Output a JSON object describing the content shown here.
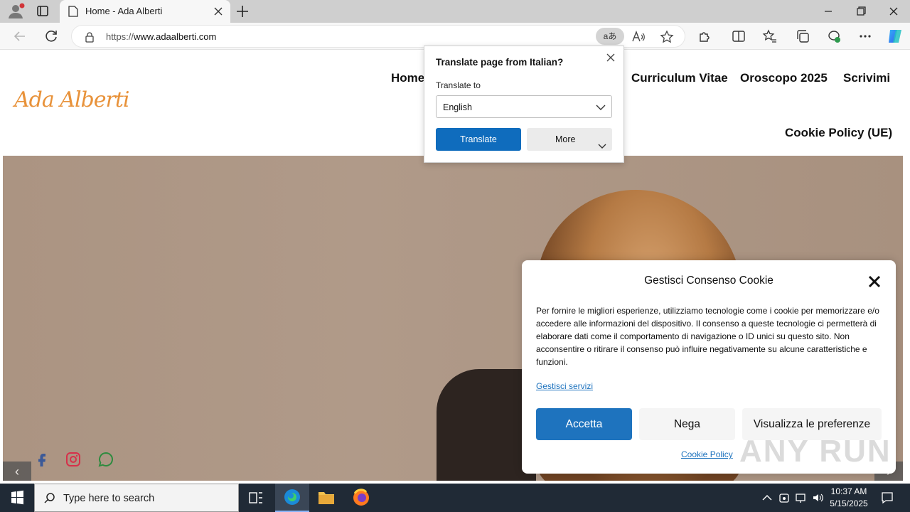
{
  "browser": {
    "tab_title": "Home - Ada Alberti",
    "url_prefix": "https://",
    "url_host": "www.adaalberti.com",
    "translate_badge": "aあ"
  },
  "site": {
    "logo": "Ada Alberti",
    "nav": {
      "home": "Home",
      "cv": "Curriculum Vitae",
      "oroscopo": "Oroscopo 2025",
      "scrivimi": "Scrivimi",
      "cookie_policy": "Cookie Policy (UE)"
    },
    "slider": {
      "prev": "‹",
      "next": "›"
    }
  },
  "translate_popup": {
    "title": "Translate page from Italian?",
    "label": "Translate to",
    "language": "English",
    "translate_button": "Translate",
    "more_button": "More"
  },
  "cookie_dialog": {
    "title": "Gestisci Consenso Cookie",
    "body": "Per fornire le migliori esperienze, utilizziamo tecnologie come i cookie per memorizzare e/o accedere alle informazioni del dispositivo. Il consenso a queste tecnologie ci permetterà di elaborare dati come il comportamento di navigazione o ID unici su questo sito. Non acconsentire o ritirare il consenso può influire negativamente su alcune caratteristiche e funzioni.",
    "manage_link": "Gestisci servizi",
    "accept": "Accetta",
    "deny": "Nega",
    "preferences": "Visualizza le preferenze",
    "policy_link": "Cookie Policy"
  },
  "watermark": "ANY RUN",
  "taskbar": {
    "search_placeholder": "Type here to search",
    "time": "10:37 AM",
    "date": "5/15/2025"
  },
  "colors": {
    "accent": "#1e73be",
    "translate_blue": "#0f6cbd",
    "logo_orange": "#e8923a"
  }
}
